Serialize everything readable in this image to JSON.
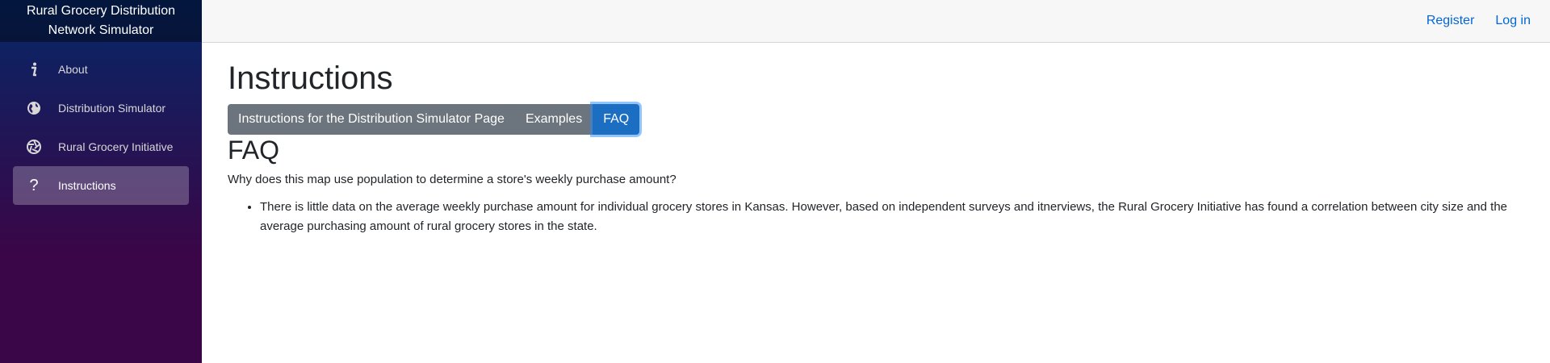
{
  "app": {
    "title": "Rural Grocery Distribution Network Simulator",
    "accent_color": "#1b6ec2",
    "link_color": "#0366d6"
  },
  "sidebar": {
    "items": [
      {
        "label": "About",
        "icon": "info-icon",
        "active": false
      },
      {
        "label": "Distribution Simulator",
        "icon": "globe-icon",
        "active": false
      },
      {
        "label": "Rural Grocery Initiative",
        "icon": "aperture-icon",
        "active": false
      },
      {
        "label": "Instructions",
        "icon": "question-mark-icon",
        "active": true
      }
    ]
  },
  "topbar": {
    "register_label": "Register",
    "login_label": "Log in"
  },
  "main": {
    "page_title": "Instructions",
    "tabs": [
      {
        "label": "Instructions for the Distribution Simulator Page",
        "active": false
      },
      {
        "label": "Examples",
        "active": false
      },
      {
        "label": "FAQ",
        "active": true
      }
    ],
    "section_title": "FAQ",
    "question": "Why does this map use population to determine a store's weekly purchase amount?",
    "answers": [
      "There is little data on the average weekly purchase amount for individual grocery stores in Kansas. However, based on independent surveys and itnerviews, the Rural Grocery Initiative has found a correlation between city size and the average purchasing amount of rural grocery stores in the state."
    ]
  }
}
